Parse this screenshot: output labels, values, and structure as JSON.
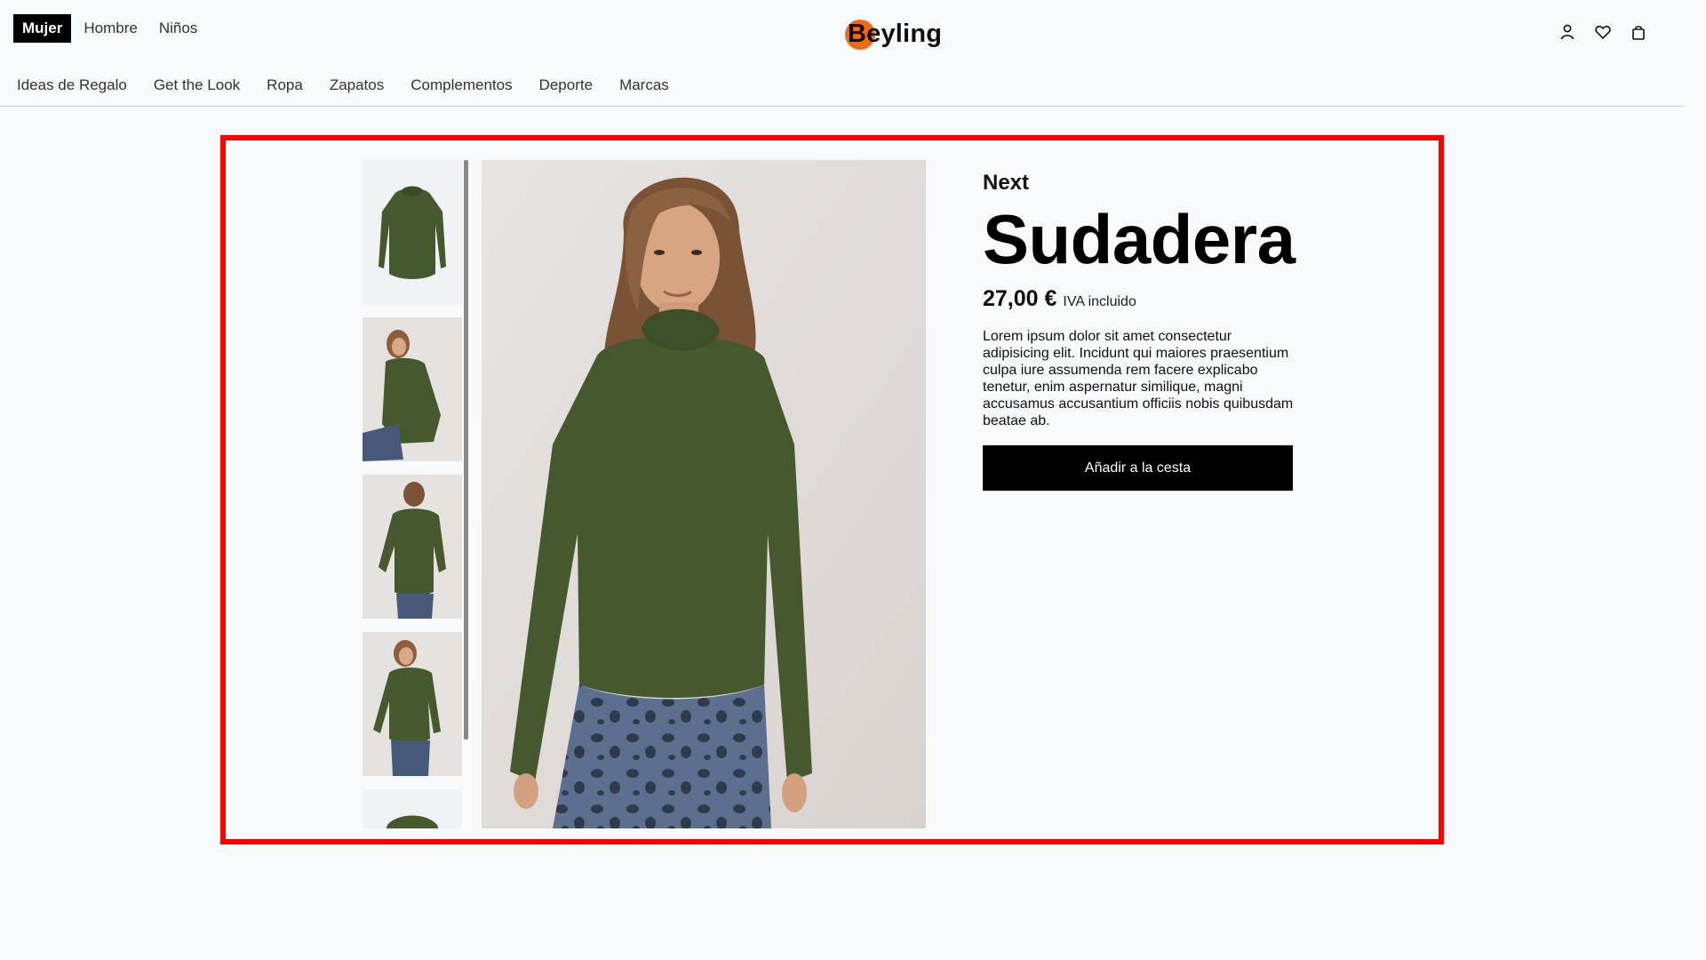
{
  "header": {
    "gender_tabs": [
      {
        "label": "Mujer",
        "active": true
      },
      {
        "label": "Hombre",
        "active": false
      },
      {
        "label": "Niños",
        "active": false
      }
    ],
    "logo": {
      "text": "Beyling",
      "accent_color": "#f26a0f"
    },
    "icons": [
      "user-icon",
      "heart-icon",
      "shopping-bag-icon"
    ],
    "categories": [
      "Ideas de Regalo",
      "Get the Look",
      "Ropa",
      "Zapatos",
      "Complementos",
      "Deporte",
      "Marcas"
    ]
  },
  "product": {
    "brand": "Next",
    "title": "Sudadera",
    "price": "27,00 €",
    "tax_note": "IVA incluido",
    "description": "Lorem ipsum dolor sit amet consectetur adipisicing elit. Incidunt qui maiores praesentium culpa iure assumenda rem facere explicabo tenetur, enim aspernatur similique, magni accusamus accusantium officiis nobis quibusdam beatae ab.",
    "add_to_cart_label": "Añadir a la cesta",
    "garment_color": "#46582e",
    "highlight_color": "#ff0000",
    "thumbnails": 5
  }
}
